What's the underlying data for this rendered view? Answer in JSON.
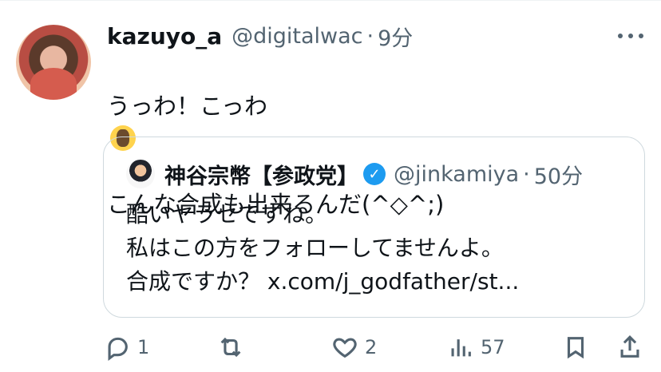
{
  "post": {
    "author_name": "kazuyo_a",
    "handle": "@digitalwac",
    "separator": "·",
    "time": "9分",
    "text_line1": "うっわ！こっわ",
    "text_line2": "こんな合成も出来るんだ(^◇^;)",
    "emoji": "scream-emoji"
  },
  "quoted": {
    "author_name": "神谷宗幣【参政党】",
    "handle": "@jinkamiya",
    "separator": "·",
    "time": "50分",
    "text": "酷いヤラセですね。\n私はこの方をフォローしてませんよ。\n合成ですか？ x.com/j_godfather/st..."
  },
  "actions": {
    "reply_count": "1",
    "like_count": "2",
    "views_count": "57"
  },
  "colors": {
    "text": "#0f1419",
    "muted": "#536471",
    "verified": "#1d9bf0",
    "border": "#cfd9de"
  },
  "icons": [
    "more-icon",
    "reply-icon",
    "retweet-icon",
    "like-icon",
    "views-icon",
    "bookmark-icon",
    "share-icon",
    "verified-icon"
  ]
}
